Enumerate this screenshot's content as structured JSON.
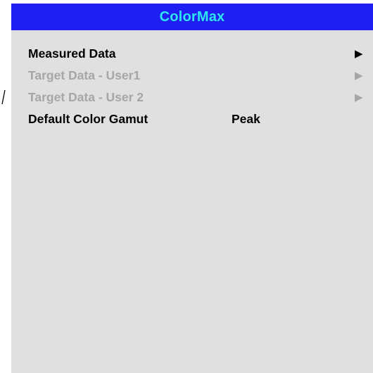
{
  "menu": {
    "title": "ColorMax",
    "items": [
      {
        "label": "Measured Data",
        "value": "",
        "state": "enabled",
        "submenu_icon": "right-triangle-icon",
        "arrow": "▶"
      },
      {
        "label": "Target Data - User1",
        "value": "",
        "state": "disabled",
        "submenu_icon": "right-triangle-icon",
        "arrow": "▶"
      },
      {
        "label": "Target Data - User 2",
        "value": "",
        "state": "disabled",
        "submenu_icon": "right-triangle-icon",
        "arrow": "▶"
      },
      {
        "label": "Default Color Gamut",
        "value": "Peak",
        "state": "enabled"
      }
    ]
  },
  "colors": {
    "header_background": "#1f1ff2",
    "header_text": "#2ee6f2",
    "panel_background": "#e0e0e0",
    "enabled_text": "#000000",
    "disabled_text": "#a6a6a6"
  }
}
